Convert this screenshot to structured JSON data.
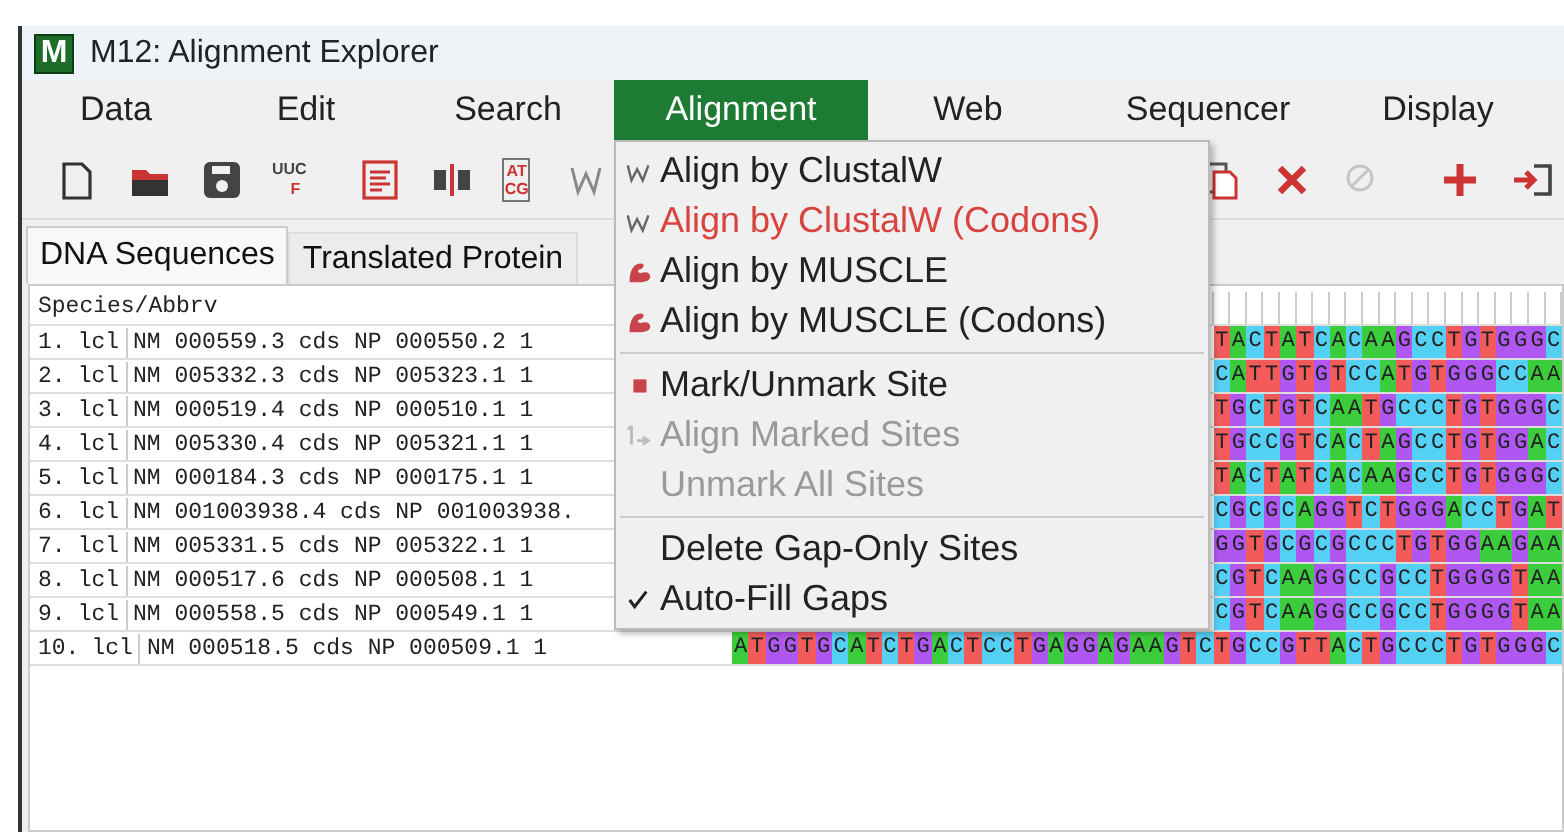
{
  "window": {
    "title": "M12: Alignment Explorer",
    "logo": "M"
  },
  "menubar": [
    {
      "label": "Data",
      "selected": false
    },
    {
      "label": "Edit",
      "selected": false
    },
    {
      "label": "Search",
      "selected": false
    },
    {
      "label": "Alignment",
      "selected": true
    },
    {
      "label": "Web",
      "selected": false
    },
    {
      "label": "Sequencer",
      "selected": false
    },
    {
      "label": "Display",
      "selected": false
    }
  ],
  "toolbar": [
    {
      "kind": "new"
    },
    {
      "kind": "open"
    },
    {
      "kind": "save"
    },
    {
      "kind": "translate",
      "top": "UUC",
      "bottom": "F"
    },
    {
      "kind": "sep"
    },
    {
      "kind": "doc"
    },
    {
      "kind": "split"
    },
    {
      "kind": "atcg",
      "top": "AT",
      "bottom": "CG"
    },
    {
      "kind": "sep"
    },
    {
      "kind": "gap"
    },
    {
      "kind": "copy"
    },
    {
      "kind": "delete"
    },
    {
      "kind": "nogap",
      "disabled": true
    },
    {
      "kind": "sep"
    },
    {
      "kind": "add"
    },
    {
      "kind": "import"
    }
  ],
  "tabs": [
    {
      "label": "DNA Sequences",
      "selected": true
    },
    {
      "label": "Translated Protein",
      "selected": false
    }
  ],
  "grid": {
    "header": "Species/Abbrv",
    "rows": [
      {
        "number": "1.",
        "prefix": "lcl",
        "name": "NM 000559.3 cds NP 000550.2 1",
        "sequence": "TACTATCACAAGCCTGTGGGC"
      },
      {
        "number": "2.",
        "prefix": "lcl",
        "name": "NM 005332.3 cds NP 005323.1 1",
        "sequence": "CATTGTGTCCATGTGGGCCAA"
      },
      {
        "number": "3.",
        "prefix": "lcl",
        "name": "NM 000519.4 cds NP 000510.1 1",
        "sequence": "TGCTGTCAATGCCCTGTGGGC"
      },
      {
        "number": "4.",
        "prefix": "lcl",
        "name": "NM 005330.4 cds NP 005321.1 1",
        "sequence": "TGCCGTCACTAGCCTGTGGAC"
      },
      {
        "number": "5.",
        "prefix": "lcl",
        "name": "NM 000184.3 cds NP 000175.1 1",
        "sequence": "TACTATCACAAGCCTGTGGGC"
      },
      {
        "number": "6.",
        "prefix": "lcl",
        "name": "NM 001003938.4 cds NP 001003938.",
        "sequence": "CGCGCAGGTCTGGGACCTGAT"
      },
      {
        "number": "7.",
        "prefix": "lcl",
        "name": "NM 005331.5 cds NP 005322.1 1",
        "sequence": "GGTGCGCGCCCTGTGGAAGAA"
      },
      {
        "number": "8.",
        "prefix": "lcl",
        "name": "NM 000517.6 cds NP 000508.1 1",
        "sequence": "CGTCAAGGCCGCCTGGGGTAA"
      },
      {
        "number": "9.",
        "prefix": "lcl",
        "name": "NM 000558.5 cds NP 000549.1 1",
        "sequence": "CGTCAAGGCCGCCTGGGGTAA"
      },
      {
        "number": "10.",
        "prefix": "lcl",
        "name": "NM 000518.5 cds NP 000509.1 1",
        "sequence": "ATGGTGCATCTGACTCCTGAGGAGAAGTCTGCCGTTACTGCCCTGTGGGC"
      }
    ]
  },
  "dropdown": {
    "sections": [
      [
        {
          "label": "Align by ClustalW",
          "kind": "clustal",
          "highlighted": false,
          "disabled": false
        },
        {
          "label": "Align by ClustalW (Codons)",
          "kind": "clustal",
          "highlighted": true,
          "disabled": false
        },
        {
          "label": "Align by MUSCLE",
          "kind": "muscle",
          "highlighted": false,
          "disabled": false
        },
        {
          "label": "Align by MUSCLE (Codons)",
          "kind": "muscle",
          "highlighted": false,
          "disabled": false
        }
      ],
      [
        {
          "label": "Mark/Unmark Site",
          "kind": "mark",
          "highlighted": false,
          "disabled": false
        },
        {
          "label": "Align Marked Sites",
          "kind": "alignmarked",
          "highlighted": false,
          "disabled": true
        },
        {
          "label": "Unmark All Sites",
          "highlighted": false,
          "disabled": true
        }
      ],
      [
        {
          "label": "Delete Gap-Only Sites",
          "highlighted": false,
          "disabled": false
        },
        {
          "label": "Auto-Fill Gaps",
          "highlighted": false,
          "disabled": false,
          "checked": true
        }
      ]
    ]
  }
}
